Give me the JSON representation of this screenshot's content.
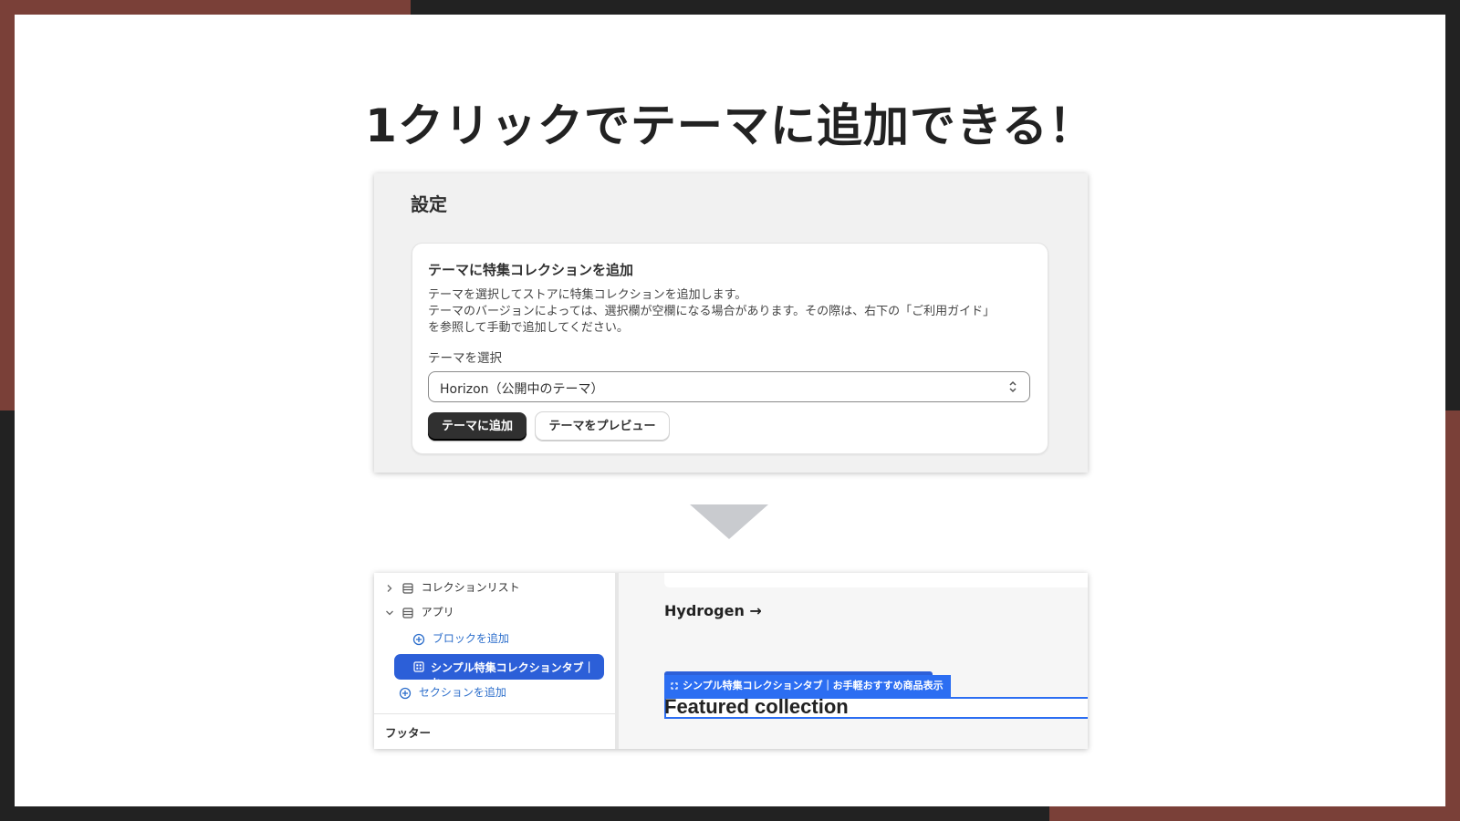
{
  "headline": "1クリックでテーマに追加できる！",
  "settings": {
    "title": "設定",
    "card": {
      "title": "テーマに特集コレクションを追加",
      "description_lines": [
        "テーマを選択してストアに特集コレクションを追加します。",
        "テーマのバージョンによっては、選択欄が空欄になる場合があります。その際は、右下の「ご利用ガイド」",
        "を参照して手動で追加してください。"
      ],
      "select_label": "テーマを選択",
      "select_value": "Horizon（公開中のテーマ）",
      "add_button": "テーマに追加",
      "preview_button": "テーマをプレビュー"
    }
  },
  "editor": {
    "sidebar": {
      "collection_list": "コレクションリスト",
      "app": "アプリ",
      "add_block": "ブロックを追加",
      "selected_block": "シンプル特集コレクションタブ｜お...",
      "add_section": "セクションを追加",
      "footer": "フッター"
    },
    "preview": {
      "hydrogen": "Hydrogen →",
      "selection_tab": "シンプル特集コレクションタブ｜お手軽おすすめ商品表示",
      "featured_collection": "Featured collection"
    }
  },
  "icons": [
    "chevron-right-icon",
    "chevron-down-icon",
    "section-icon",
    "plus-circle-icon",
    "app-block-icon",
    "select-chevrons-icon"
  ],
  "colors": {
    "frame_accent": "#7a4038",
    "frame_dark": "#222222",
    "primary_button": "#303030",
    "selection_blue": "#2c6ef2"
  }
}
